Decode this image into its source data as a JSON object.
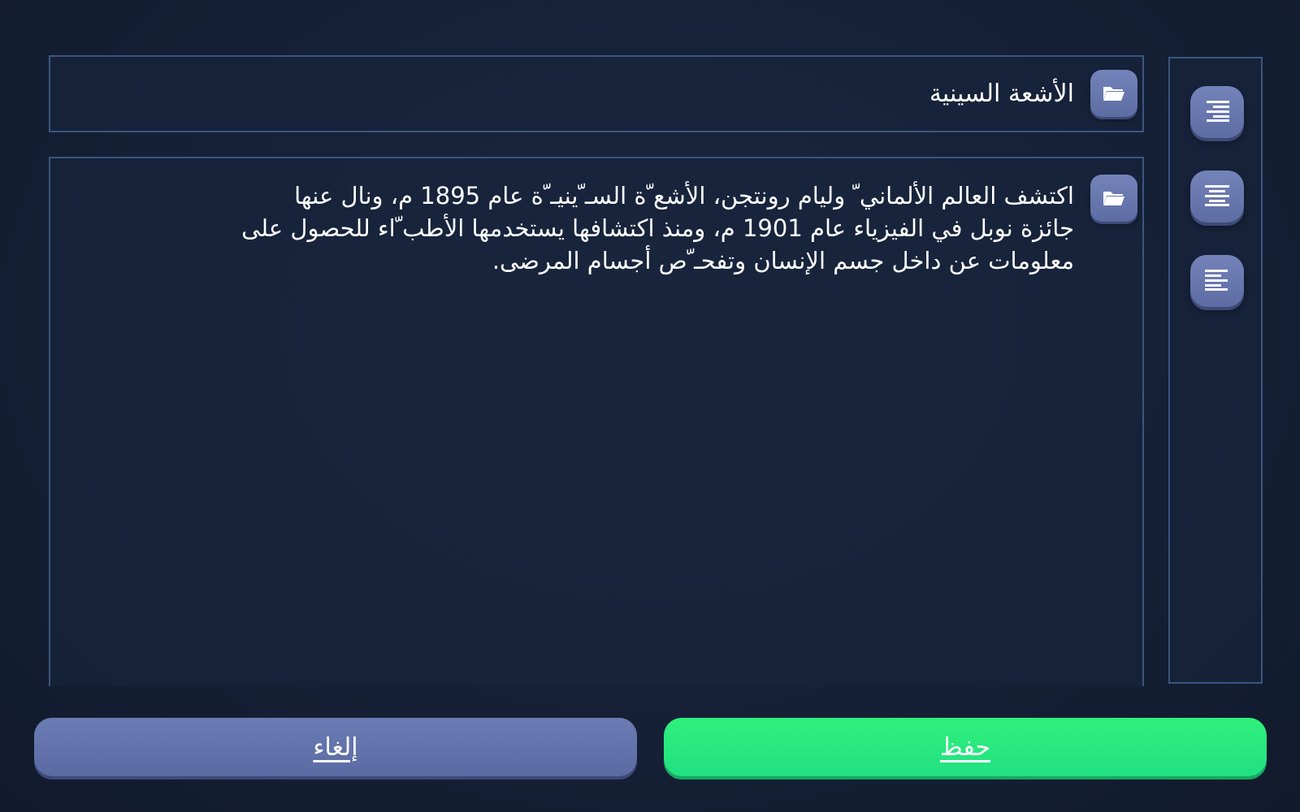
{
  "title_field": {
    "value": "الأشعة السينية",
    "icon": "folder-icon"
  },
  "content_field": {
    "value": "اكتشف العالم الألماني ّ وليام رونتجن، الأشع ّة السـ ّينيـ ّة عام 1895 م، ونال عنها جائزة نوبل في الفيزياء عام 1901 م، ومنذ اكتشافها يستخدمها الأطب ّاء للحصول على معلومات عن داخل جسم الإنسان وتفحـ ّص أجسام المرضى.",
    "icon": "folder-icon"
  },
  "alignment_panel": {
    "items": [
      {
        "icon": "align-right-icon"
      },
      {
        "icon": "align-center-icon"
      },
      {
        "icon": "align-left-icon"
      }
    ]
  },
  "actions": {
    "cancel_label": "إلغاء",
    "save_label": "حفظ"
  },
  "colors": {
    "background": "#152036",
    "panel_border": "#3c5580",
    "button_blue": "#6475ad",
    "button_green": "#25e880"
  }
}
